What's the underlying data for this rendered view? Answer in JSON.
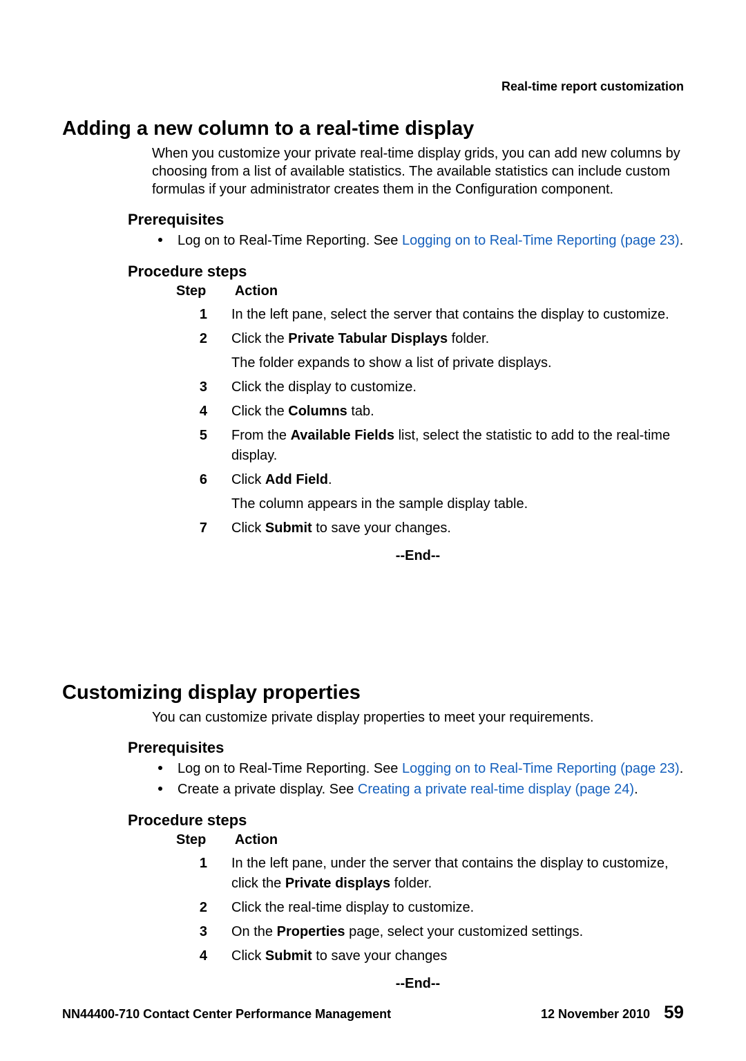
{
  "running_header": "Real-time report customization",
  "section1": {
    "title": "Adding a new column to a real-time display",
    "intro": "When you customize your private real-time display grids, you can add new columns by choosing from a list of available statistics. The available statistics can include custom formulas if your administrator creates them in the Configuration component.",
    "prereq_heading": "Prerequisites",
    "prereq_items": [
      {
        "pre": "Log on to Real-Time Reporting. See ",
        "link": "Logging on to Real-Time Reporting (page 23)",
        "post": "."
      }
    ],
    "proc_heading": "Procedure steps",
    "step_label": "Step",
    "action_label": "Action",
    "steps": [
      {
        "num": "1",
        "parts": [
          {
            "t": "In the left pane, select the server that contains the display to customize."
          }
        ]
      },
      {
        "num": "2",
        "parts": [
          {
            "t": "Click the "
          },
          {
            "t": "Private Tabular Displays",
            "b": true
          },
          {
            "t": " folder."
          }
        ],
        "sub": "The folder expands to show a list of private displays."
      },
      {
        "num": "3",
        "parts": [
          {
            "t": "Click the display to customize."
          }
        ]
      },
      {
        "num": "4",
        "parts": [
          {
            "t": "Click the "
          },
          {
            "t": "Columns",
            "b": true
          },
          {
            "t": " tab."
          }
        ]
      },
      {
        "num": "5",
        "parts": [
          {
            "t": "From the "
          },
          {
            "t": "Available Fields",
            "b": true
          },
          {
            "t": " list, select the statistic to add to the real-time display."
          }
        ]
      },
      {
        "num": "6",
        "parts": [
          {
            "t": "Click "
          },
          {
            "t": "Add Field",
            "b": true
          },
          {
            "t": "."
          }
        ],
        "sub": "The column appears in the sample display table."
      },
      {
        "num": "7",
        "parts": [
          {
            "t": "Click "
          },
          {
            "t": "Submit",
            "b": true
          },
          {
            "t": " to save your changes."
          }
        ]
      }
    ],
    "end": "--End--"
  },
  "section2": {
    "title": "Customizing display properties",
    "intro": "You can customize private display properties to meet your requirements.",
    "prereq_heading": "Prerequisites",
    "prereq_items": [
      {
        "pre": "Log on to Real-Time Reporting. See ",
        "link": "Logging on to Real-Time Reporting (page 23)",
        "post": "."
      },
      {
        "pre": "Create a private display. See ",
        "link": "Creating a private real-time display (page 24)",
        "post": "."
      }
    ],
    "proc_heading": "Procedure steps",
    "step_label": "Step",
    "action_label": "Action",
    "steps": [
      {
        "num": "1",
        "parts": [
          {
            "t": "In the left pane, under the server that contains the display to customize, click the "
          },
          {
            "t": "Private displays",
            "b": true
          },
          {
            "t": " folder."
          }
        ]
      },
      {
        "num": "2",
        "parts": [
          {
            "t": "Click the real-time display to customize."
          }
        ]
      },
      {
        "num": "3",
        "parts": [
          {
            "t": "On the "
          },
          {
            "t": "Properties",
            "b": true
          },
          {
            "t": " page, select your customized settings."
          }
        ]
      },
      {
        "num": "4",
        "parts": [
          {
            "t": "Click "
          },
          {
            "t": "Submit",
            "b": true
          },
          {
            "t": " to save your changes"
          }
        ]
      }
    ],
    "end": "--End--"
  },
  "footer": {
    "doc_id": "NN44400-710 Contact Center Performance Management",
    "date": "12 November 2010",
    "page": "59"
  }
}
